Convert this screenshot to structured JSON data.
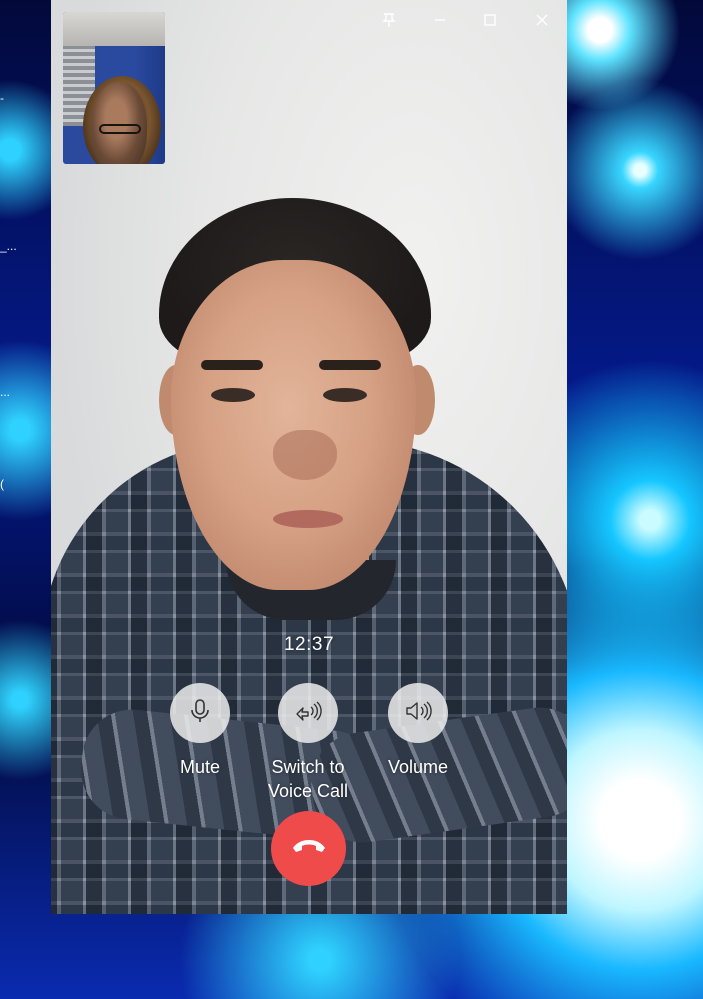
{
  "window": {
    "controls": {
      "pin_icon": "pin-icon",
      "minimize_icon": "minimize-icon",
      "maximize_icon": "maximize-icon",
      "close_icon": "close-icon"
    }
  },
  "call": {
    "timer": "12:37",
    "controls": [
      {
        "id": "mute",
        "icon": "microphone-icon",
        "label_lines": [
          "Mute"
        ]
      },
      {
        "id": "switch",
        "icon": "switch-voice-call-icon",
        "label_lines": [
          "Switch to",
          "Voice Call"
        ]
      },
      {
        "id": "volume",
        "icon": "speaker-icon",
        "label_lines": [
          "Volume"
        ]
      }
    ],
    "hangup_icon": "hang-up-icon"
  },
  "desktop_fragments": [
    "-",
    "_...",
    "...",
    "("
  ],
  "colors": {
    "hangup": "#f04b4b",
    "control_circle": "#ececec",
    "overlay_text": "#ffffff"
  }
}
